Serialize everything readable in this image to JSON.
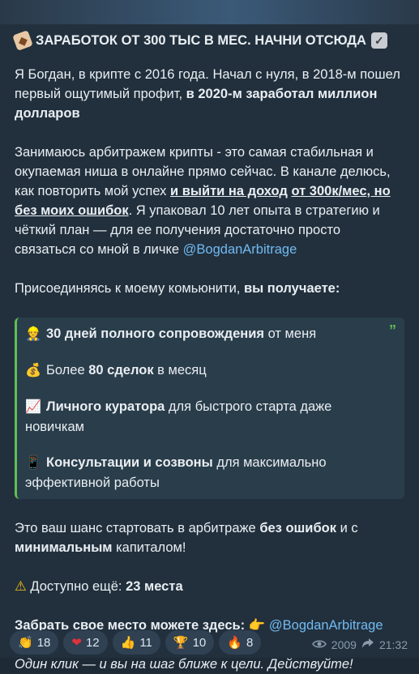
{
  "post": {
    "title": "ЗАРАБОТОК ОТ 300 ТЫС В МЕС. НАЧНИ ОТСЮДА",
    "p1_a": "Я Богдан, в крипте с 2016 года. Начал с нуля, в 2018-м пошел первый ощутимый профит, ",
    "p1_b": "в 2020-м заработал миллион долларов",
    "p2_a": "Занимаюсь арбитражем крипты  - это самая стабильная и окупаемая ниша в онлайне прямо сейчас. В канале делюсь, как повторить мой успех ",
    "p2_b": "и выйти на доход",
    "p2_c": " ",
    "p2_d": "от 300к/мес, но без моих ошибок",
    "p2_e": ". Я упаковал 10 лет опыта в стратегию и чёткий план — для ее получения достаточно просто связаться со мной в личке ",
    "p2_mention": "@BogdanArbitrage",
    "p3_a": "Присоединяясь к моему комьюнити, ",
    "p3_b": "вы получаете:",
    "quote": {
      "r1_b": "30 дней полного сопровождения",
      "r1_t": " от меня",
      "r2_t1": "Более ",
      "r2_b": "80 сделок",
      "r2_t2": " в месяц",
      "r3_b": "Личного куратора",
      "r3_t": " для быстрого старта даже новичкам",
      "r4_b": "Консультации и созвоны",
      "r4_t": " для максимально эффективной работы"
    },
    "p4_a": "Это ваш шанс стартовать в арбитраже ",
    "p4_b": "без ошибок",
    "p4_c": " и с ",
    "p4_d": "минимальным",
    "p4_e": " капиталом!",
    "p5_a": " Доступно ещё: ",
    "p5_b": "23 места",
    "p6_b": "Забрать свое место можете здесь:",
    "p6_mention": "@BogdanArbitrage",
    "p7": "Один клик — и вы на шаг ближе к цели. Действуйте!"
  },
  "reactions": [
    {
      "emoji": "👏",
      "count": "18"
    },
    {
      "emoji": "❤",
      "count": "12"
    },
    {
      "emoji": "👍",
      "count": "11"
    },
    {
      "emoji": "🏆",
      "count": "10"
    },
    {
      "emoji": "🔥",
      "count": "8"
    }
  ],
  "meta": {
    "views": "2009",
    "time": "21:32"
  }
}
